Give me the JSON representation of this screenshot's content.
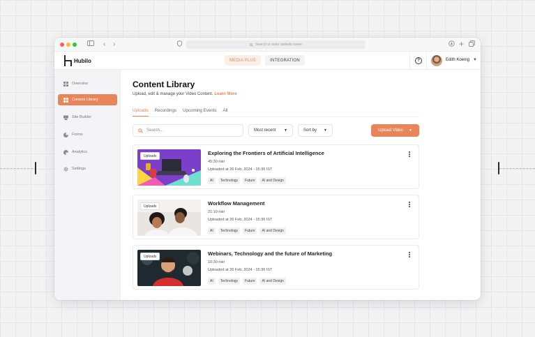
{
  "browser": {
    "address_placeholder": "Search or enter website name"
  },
  "appbar": {
    "logo_text": "Hubilo",
    "media_plus": "MEDIA PLUS",
    "integration": "INTEGRATION",
    "help_glyph": "?",
    "user_name": "Edith Koenig"
  },
  "sidebar": {
    "items": [
      {
        "label": "Overview",
        "icon": "grid-icon"
      },
      {
        "label": "Content Library",
        "icon": "library-icon"
      },
      {
        "label": "Site Builder",
        "icon": "site-builder-icon"
      },
      {
        "label": "Forms",
        "icon": "forms-icon"
      },
      {
        "label": "Analytics",
        "icon": "analytics-icon"
      },
      {
        "label": "Settings",
        "icon": "gear-icon"
      }
    ],
    "active_index": 1
  },
  "main": {
    "title": "Content Library",
    "subtitle": "Upload, edit & manage your Video Content.",
    "learn_more": "Learn More",
    "tabs": [
      "Uploads",
      "Recordings",
      "Upcoming Events",
      "All"
    ],
    "active_tab": 0,
    "search_placeholder": "Search...",
    "most_recent": "Most recent",
    "sort_by": "Sort by",
    "upload_button": "Upload Video"
  },
  "accent_color": "#e8855a",
  "videos": [
    {
      "badge": "Uploads",
      "title": "Exploring the Frontiers of Artificial Intelligence",
      "duration": "45:30 min",
      "uploaded": "Uploaded at 26 Feb, 2024 - 15:36 IST",
      "tags": [
        "AI",
        "Technology",
        "Future",
        "AI and Design"
      ]
    },
    {
      "badge": "Uploads",
      "title": "Workflow Management",
      "duration": "21:10 min",
      "uploaded": "Uploaded at 26 Feb, 2024 - 15:36 IST",
      "tags": [
        "AI",
        "Technology",
        "Future",
        "AI and Design"
      ]
    },
    {
      "badge": "Uploads",
      "title": "Webinars, Technology and the future of Marketing",
      "duration": "10:30 min",
      "uploaded": "Uploaded at 26 Feb, 2024 - 15:36 IST",
      "tags": [
        "AI",
        "Technology",
        "Future",
        "AI and Design"
      ]
    }
  ]
}
